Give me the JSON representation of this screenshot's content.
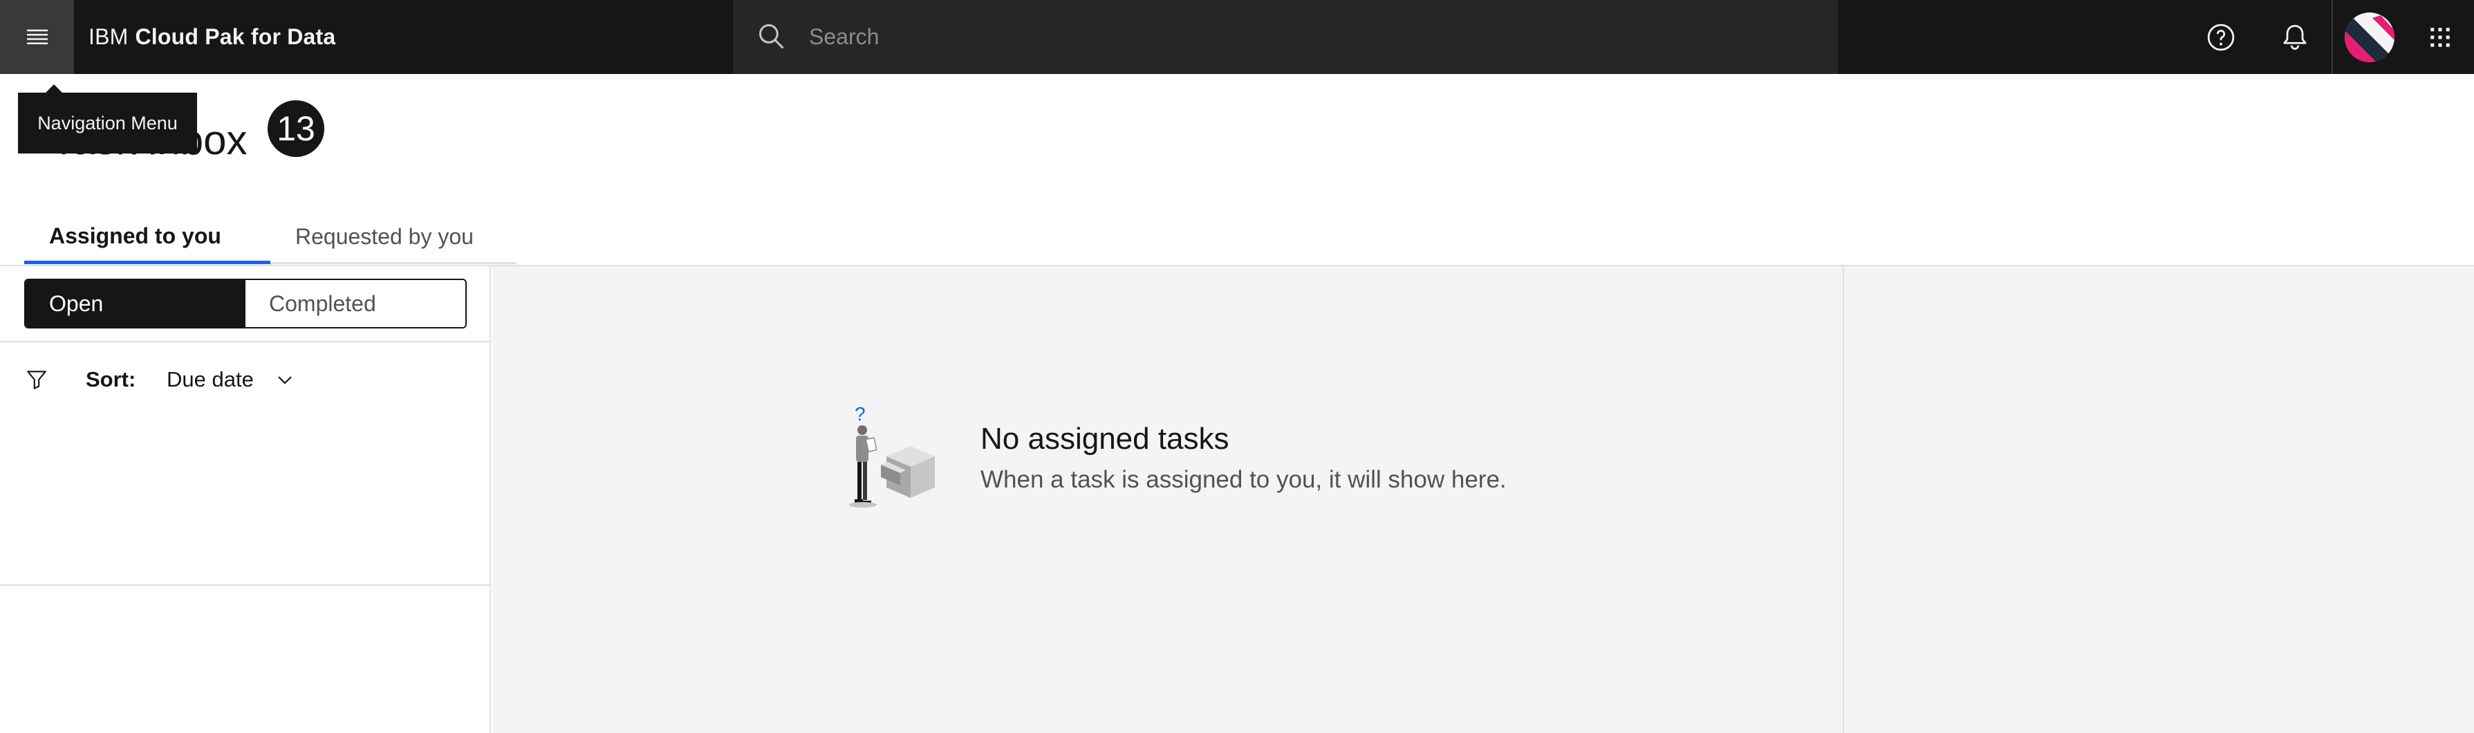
{
  "header": {
    "menu_tooltip": "Navigation Menu",
    "brand": "IBM",
    "product_name": "Cloud Pak for Data",
    "search_placeholder": "Search",
    "icons": [
      "menu-icon",
      "search-icon",
      "help-icon",
      "notification-icon",
      "avatar",
      "app-switcher-icon"
    ]
  },
  "page": {
    "title": "Task inbox",
    "count_badge": "13"
  },
  "tabs": [
    {
      "label": "Assigned to you",
      "active": true
    },
    {
      "label": "Requested by you",
      "active": false
    }
  ],
  "filters": {
    "switcher": [
      {
        "label": "Open",
        "selected": true
      },
      {
        "label": "Completed",
        "selected": false
      }
    ],
    "sort_label": "Sort:",
    "sort_value": "Due date"
  },
  "empty_state": {
    "title": "No assigned tasks",
    "description": "When a task is assigned to you, it will show here."
  },
  "colors": {
    "header_bg": "#161616",
    "search_bg": "#262626",
    "accent": "#0f62fe",
    "panel_bg": "#f4f4f4"
  }
}
